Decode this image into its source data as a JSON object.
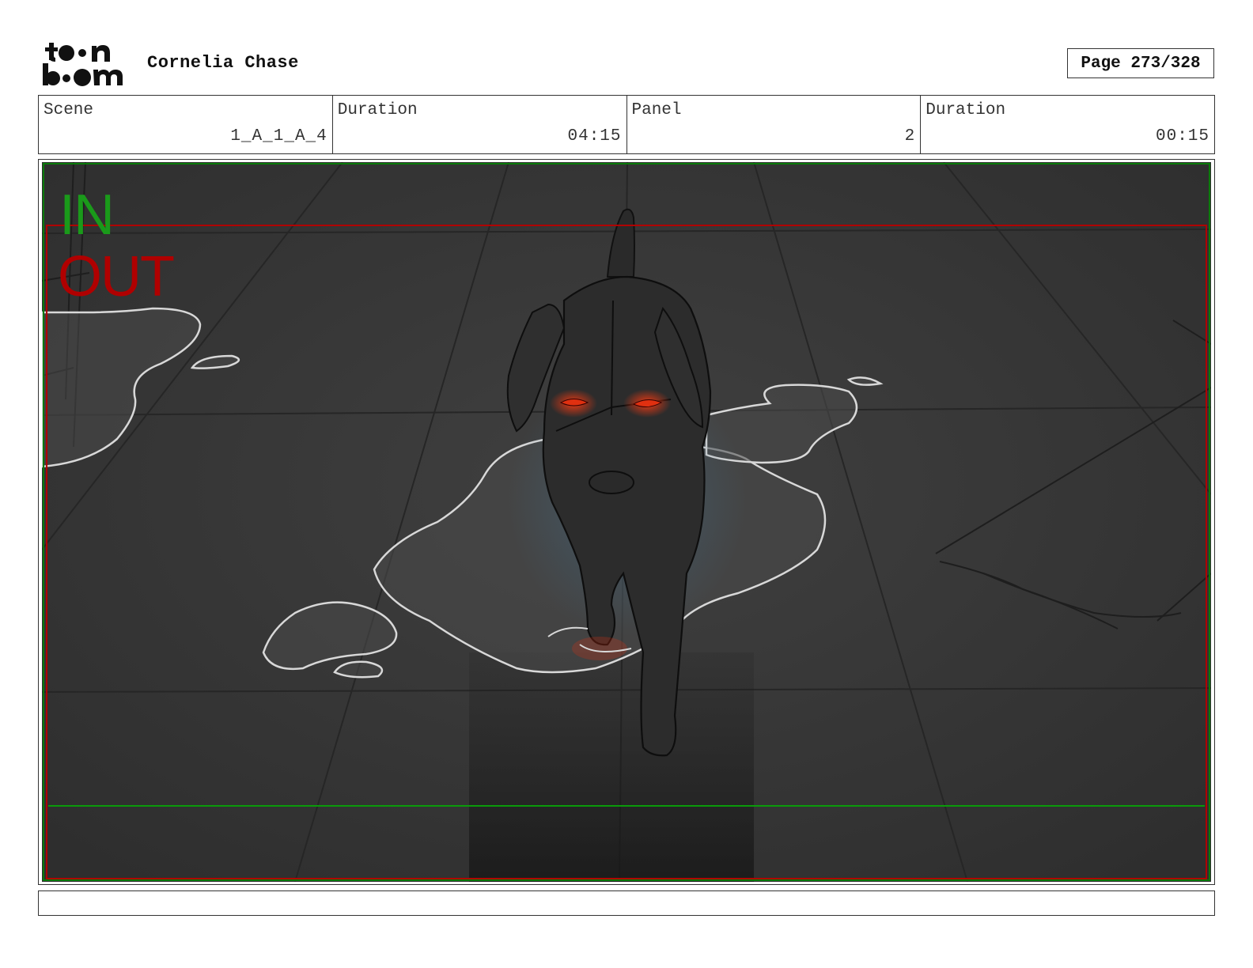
{
  "header": {
    "logo_text": "toon boom",
    "project_title": "Cornelia Chase",
    "page_label": "Page 273/328"
  },
  "info": [
    {
      "label": "Scene",
      "value": "1_A_1_A_4"
    },
    {
      "label": "Duration",
      "value": "04:15"
    },
    {
      "label": "Panel",
      "value": "2"
    },
    {
      "label": "Duration",
      "value": "00:15"
    }
  ],
  "frame": {
    "in_label": "IN",
    "out_label": "OUT",
    "in_color": "#1a9a1a",
    "out_color": "#b00000",
    "background_color": "#3a3a3a",
    "eye_color": "#e03010"
  },
  "notes": {
    "text": ""
  }
}
